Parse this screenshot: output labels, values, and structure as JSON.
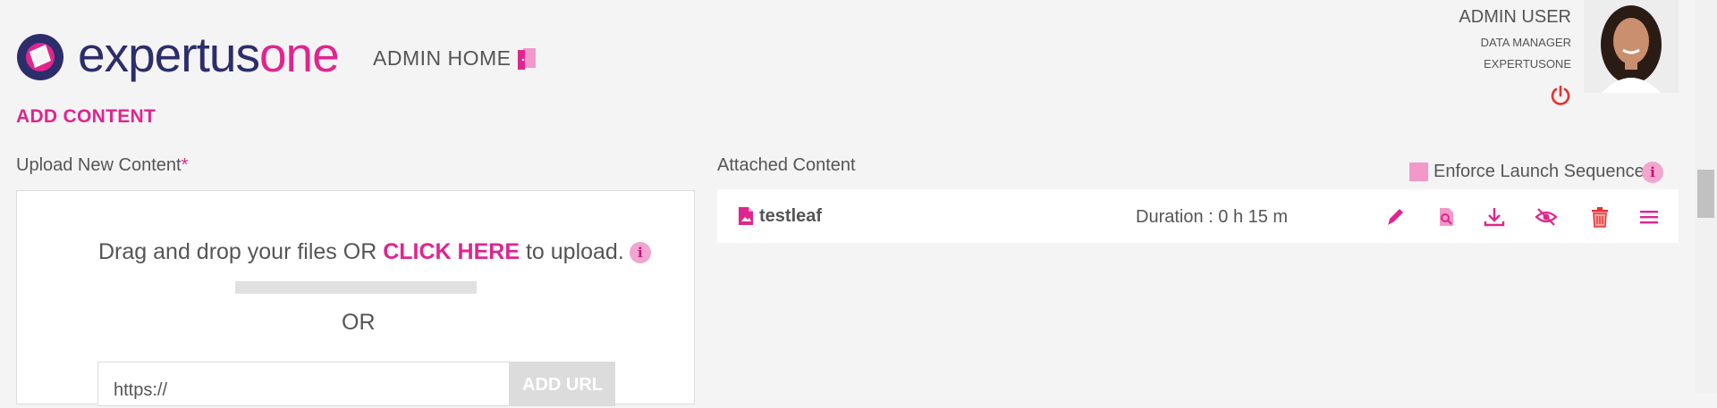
{
  "header": {
    "logo": {
      "part1": "expertus",
      "part2": "one"
    },
    "admin_home": "ADMIN HOME",
    "user": {
      "name": "ADMIN USER",
      "role": "DATA MANAGER",
      "org": "EXPERTUSONE"
    }
  },
  "section": {
    "title": "ADD CONTENT"
  },
  "upload": {
    "label": "Upload New Content",
    "required_mark": "*",
    "dnd_prefix": "Drag and drop your files OR",
    "dnd_link": "CLICK HERE",
    "dnd_suffix": "to upload.",
    "info": "i",
    "or": "OR",
    "url_value": "https://",
    "add_url": "ADD URL"
  },
  "attached": {
    "label": "Attached Content",
    "enforce_label": "Enforce Launch Sequence",
    "enforce_checked": false,
    "info": "i",
    "items": [
      {
        "name": "testleaf",
        "duration": "Duration : 0 h 15 m"
      }
    ],
    "actions": [
      "edit-icon",
      "preview-icon",
      "download-icon",
      "hide-icon",
      "delete-icon",
      "reorder-icon"
    ]
  },
  "colors": {
    "accent": "#e0258f",
    "navy": "#2c2d6b",
    "text": "#555555",
    "background": "#f4f4f4",
    "danger": "#e8302f"
  }
}
